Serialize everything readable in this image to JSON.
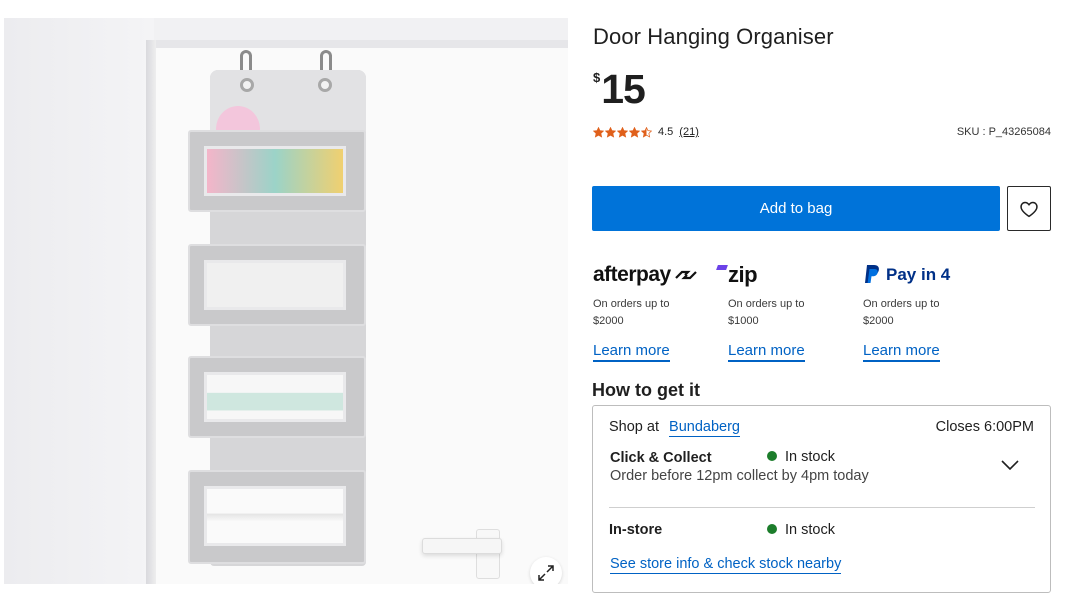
{
  "product": {
    "title": "Door Hanging Organiser",
    "price_symbol": "$",
    "price_amount": "15",
    "rating": "4.5",
    "rating_value": 4.5,
    "review_count": "(21)",
    "sku": "SKU : P_43265084"
  },
  "actions": {
    "add_to_bag": "Add to bag"
  },
  "payments": [
    {
      "brand": "afterpay",
      "logo_text": "afterpay",
      "line1": "On orders up to",
      "line2": "$2000",
      "link": "Learn more"
    },
    {
      "brand": "zip",
      "logo_text": "zip",
      "line1": "On orders up to",
      "line2": "$1000",
      "link": "Learn more"
    },
    {
      "brand": "paypal",
      "logo_text": "Pay in 4",
      "line1": "On orders up to",
      "line2": "$2000",
      "link": "Learn more"
    }
  ],
  "fulfilment": {
    "heading": "How to get it",
    "shop_at_label": "Shop at",
    "store_name": "Bundaberg",
    "closes": "Closes 6:00PM",
    "click_collect": {
      "title": "Click & Collect",
      "status": "In stock",
      "note": "Order before 12pm collect by 4pm today"
    },
    "in_store": {
      "title": "In-store",
      "status": "In stock"
    },
    "store_info_link": "See store info & check stock nearby"
  },
  "colors": {
    "primary_button": "#0073d9",
    "link": "#0062c4",
    "stock_green": "#1c7d2b",
    "star": "#e0601b",
    "afterpay_text": "#111111",
    "zip_purple": "#6b42e8",
    "paypal_blue": "#003087"
  },
  "icons": {
    "wishlist": "heart-outline-icon",
    "expand": "expand-arrows-icon",
    "collapse": "chevron-down-icon",
    "stock": "green-dot-icon"
  }
}
